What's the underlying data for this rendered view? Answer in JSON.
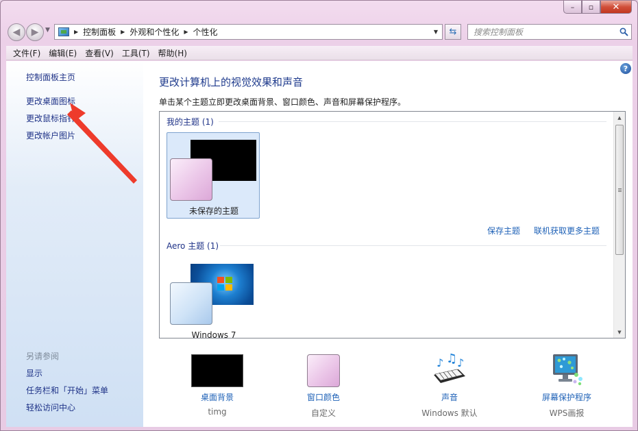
{
  "window": {
    "caption": {
      "minimize": "–",
      "maximize": "▫",
      "close": "✕"
    }
  },
  "address_bar": {
    "crumbs": [
      "控制面板",
      "外观和个性化",
      "个性化"
    ]
  },
  "search": {
    "placeholder": "搜索控制面板"
  },
  "menu": [
    "文件(F)",
    "编辑(E)",
    "查看(V)",
    "工具(T)",
    "帮助(H)"
  ],
  "sidebar": {
    "home": "控制面板主页",
    "links": [
      "更改桌面图标",
      "更改鼠标指针",
      "更改帐户图片"
    ],
    "see_also_title": "另请参阅",
    "see_also": [
      "显示",
      "任务栏和「开始」菜单",
      "轻松访问中心"
    ]
  },
  "main": {
    "title": "更改计算机上的视觉效果和声音",
    "description": "单击某个主题立即更改桌面背景、窗口颜色、声音和屏幕保护程序。",
    "groups": [
      {
        "header": "我的主题 (1)",
        "themes": [
          {
            "label": "未保存的主题",
            "selected": true
          }
        ]
      },
      {
        "header": "Aero 主题 (1)",
        "themes": [
          {
            "label": "Windows 7",
            "selected": false
          }
        ]
      }
    ],
    "save_theme": "保存主题",
    "get_more_themes": "联机获取更多主题"
  },
  "quick_settings": [
    {
      "label": "桌面背景",
      "value": "timg"
    },
    {
      "label": "窗口颜色",
      "value": "自定义"
    },
    {
      "label": "声音",
      "value": "Windows 默认"
    },
    {
      "label": "屏幕保护程序",
      "value": "WPS画报"
    }
  ],
  "colors": {
    "link": "#1f62b7",
    "title_blue": "#1e3a8c",
    "annotation_arrow": "#ee3b2b"
  }
}
